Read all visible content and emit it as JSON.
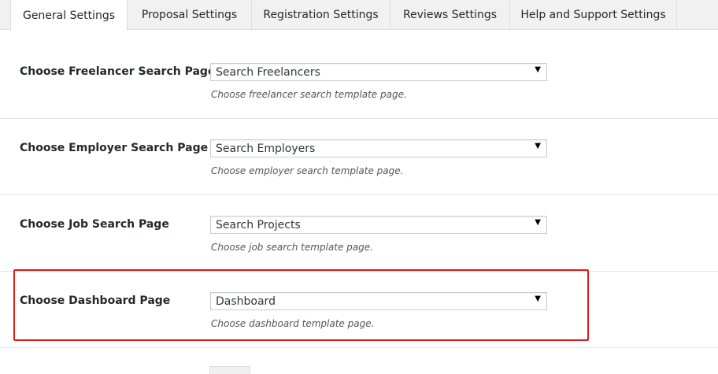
{
  "tabs": [
    {
      "label": "General Settings",
      "active": true
    },
    {
      "label": "Proposal Settings",
      "active": false
    },
    {
      "label": "Registration Settings",
      "active": false
    },
    {
      "label": "Reviews Settings",
      "active": false
    },
    {
      "label": "Help and Support Settings",
      "active": false
    }
  ],
  "settings": [
    {
      "label": "Choose Freelancer Search Page",
      "selected": "Search Freelancers",
      "description": "Choose freelancer search template page."
    },
    {
      "label": "Choose Employer Search Page",
      "selected": "Search Employers",
      "description": "Choose employer search template page."
    },
    {
      "label": "Choose Job Search Page",
      "selected": "Search Projects",
      "description": "Choose job search template page."
    },
    {
      "label": "Choose Dashboard Page",
      "selected": "Dashboard",
      "description": "Choose dashboard template page."
    }
  ],
  "dropdown_arrow": "▼",
  "highlight_color": "#e01b1b"
}
